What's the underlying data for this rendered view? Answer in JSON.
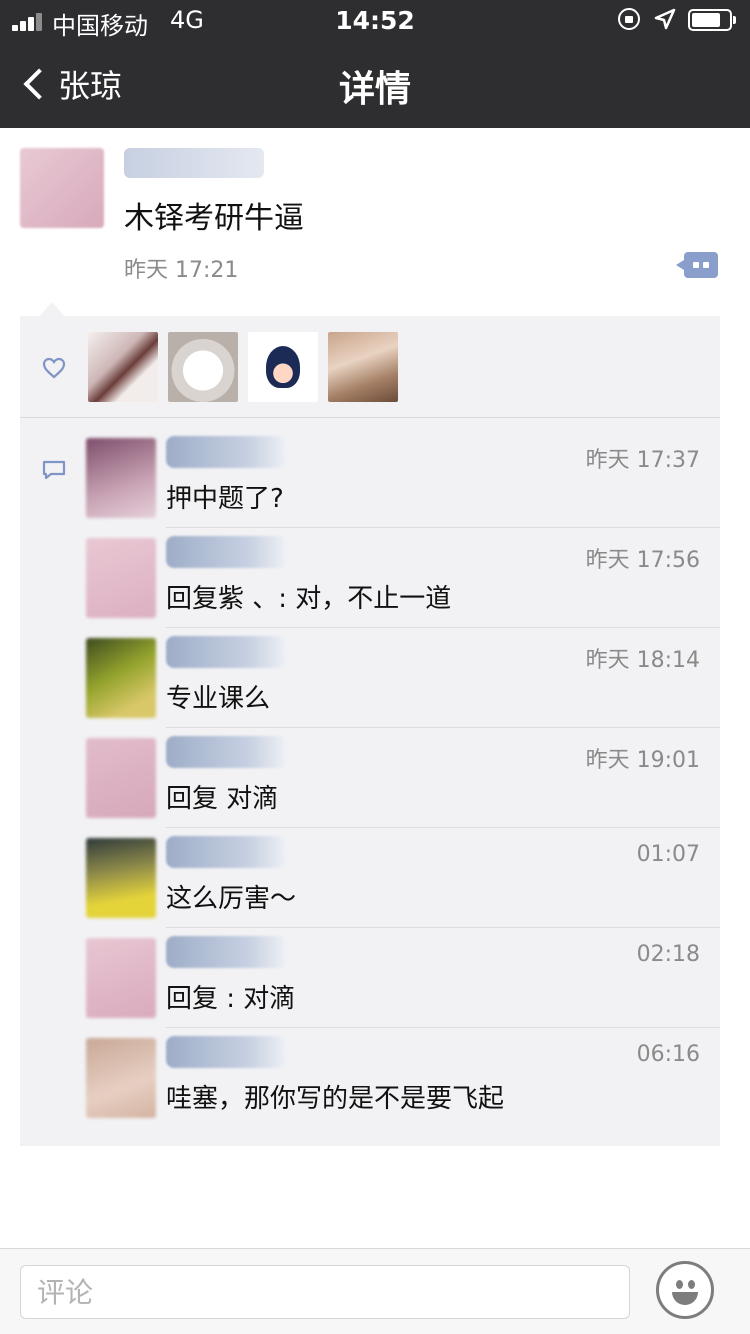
{
  "status_bar": {
    "carrier": "中国移动",
    "network": "4G",
    "time": "14:52",
    "icons": [
      "signal-icon",
      "rotation-lock-icon",
      "location-arrow-icon",
      "battery-icon"
    ]
  },
  "nav": {
    "back_label": "张琼",
    "title": "详情"
  },
  "post": {
    "text": "木铎考研牛逼",
    "time": "昨天 17:21"
  },
  "likes": {
    "icon": "heart-icon",
    "count_shown": 4
  },
  "comments": [
    {
      "time": "昨天 17:37",
      "text": "押中题了?"
    },
    {
      "time": "昨天 17:56",
      "text": "回复紫      、: 对，不止一道"
    },
    {
      "time": "昨天 18:14",
      "text": "专业课么"
    },
    {
      "time": "昨天 19:01",
      "text": "回复         对滴"
    },
    {
      "time": "01:07",
      "text": "这么厉害～"
    },
    {
      "time": "02:18",
      "text": "回复      : 对滴"
    },
    {
      "time": "06:16",
      "text": "哇塞，那你写的是不是要飞起"
    }
  ],
  "input": {
    "placeholder": "评论",
    "value": ""
  },
  "colors": {
    "nav_bg": "#2e2e31",
    "panel_bg": "#f2f2f4",
    "link_blue": "#8a9ecc",
    "time_gray": "#8a8a8a"
  }
}
